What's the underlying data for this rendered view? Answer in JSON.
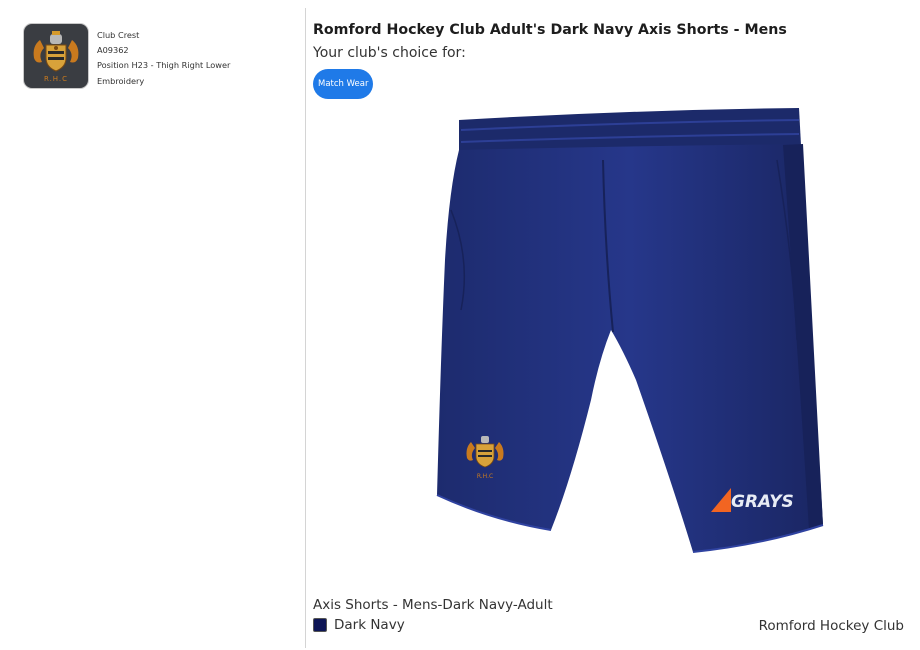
{
  "crest": {
    "name": "Club Crest",
    "code": "A09362",
    "position": "Position H23 - Thigh Right Lower",
    "method": "Embroidery",
    "initials": "R.H.C"
  },
  "product": {
    "title": "Romford Hockey Club Adult's Dark Navy Axis Shorts - Mens",
    "choice_label": "Your club's choice for:",
    "tag": "Match Wear",
    "brand": "GRAYS",
    "variant": "Axis Shorts - Mens-Dark Navy-Adult",
    "color_name": "Dark Navy",
    "club": "Romford Hockey Club"
  },
  "colors": {
    "accent": "#1f7ae8",
    "navy": "#1a2a6c",
    "swatch": "#0d1555",
    "brand_orange": "#f26522"
  }
}
